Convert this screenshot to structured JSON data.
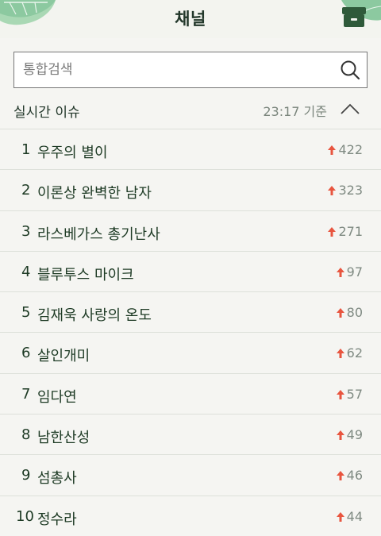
{
  "header": {
    "title": "채널"
  },
  "search": {
    "placeholder": "통합검색"
  },
  "issues": {
    "title": "실시간 이슈",
    "time": "23:17 기준",
    "items": [
      {
        "rank": "1",
        "keyword": "우주의 별이",
        "change": "422"
      },
      {
        "rank": "2",
        "keyword": "이론상 완벽한 남자",
        "change": "323"
      },
      {
        "rank": "3",
        "keyword": "라스베가스 총기난사",
        "change": "271"
      },
      {
        "rank": "4",
        "keyword": "블루투스 마이크",
        "change": "97"
      },
      {
        "rank": "5",
        "keyword": "김재욱 사랑의 온도",
        "change": "80"
      },
      {
        "rank": "6",
        "keyword": "살인개미",
        "change": "62"
      },
      {
        "rank": "7",
        "keyword": "임다연",
        "change": "57"
      },
      {
        "rank": "8",
        "keyword": "남한산성",
        "change": "49"
      },
      {
        "rank": "9",
        "keyword": "섬총사",
        "change": "46"
      },
      {
        "rank": "10",
        "keyword": "정수라",
        "change": "44"
      }
    ]
  },
  "icons": {
    "archive": "archive-box-icon",
    "search": "search-icon",
    "collapse": "chevron-up-icon",
    "rise": "arrow-up-icon"
  },
  "colors": {
    "accent_green": "#2f5a3a",
    "rise_red": "#e8553f",
    "leaf": "#8cc9a0"
  }
}
